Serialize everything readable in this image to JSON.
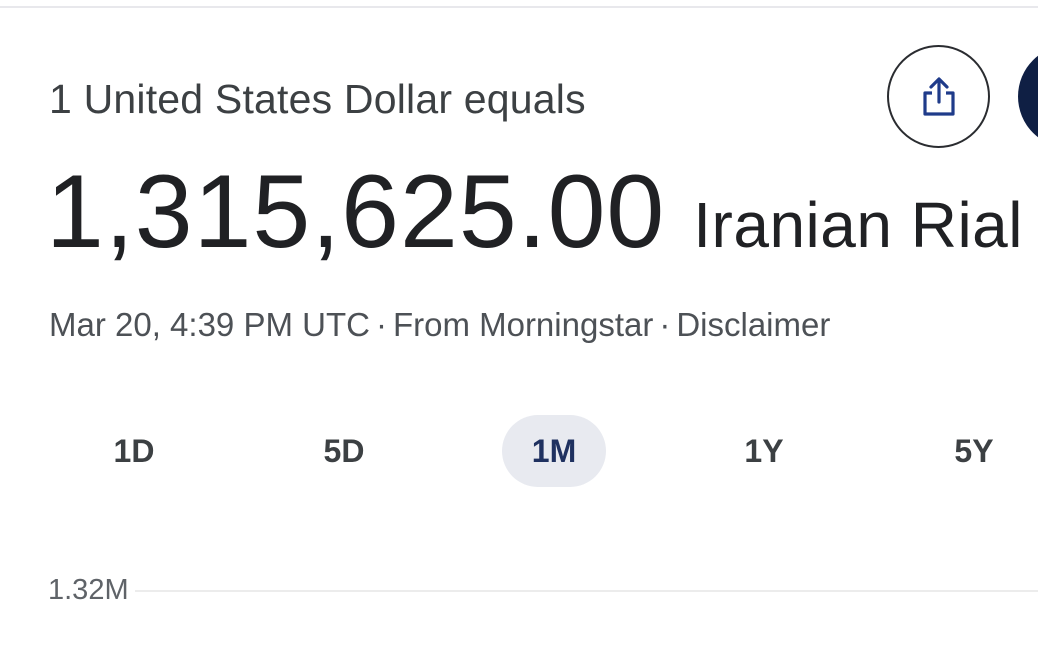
{
  "header": {
    "equals_text": "1 United States Dollar equals"
  },
  "conversion": {
    "value": "1,315,625.00",
    "currency": "Iranian Rial"
  },
  "meta": {
    "timestamp": "Mar 20, 4:39 PM UTC",
    "separator": "·",
    "source": "From Morningstar",
    "disclaimer": "Disclaimer"
  },
  "actions": {
    "share_icon": "share-icon"
  },
  "range_tabs": [
    {
      "label": "1D",
      "active": false
    },
    {
      "label": "5D",
      "active": false
    },
    {
      "label": "1M",
      "active": true
    },
    {
      "label": "1Y",
      "active": false
    },
    {
      "label": "5Y",
      "active": false
    }
  ],
  "chart": {
    "y_tick": "1.32M"
  },
  "colors": {
    "active_tab_bg": "#e8eaf0",
    "active_tab_text": "#1f3160",
    "share_icon": "#1f3b8a",
    "next_button": "#0f1f44"
  }
}
